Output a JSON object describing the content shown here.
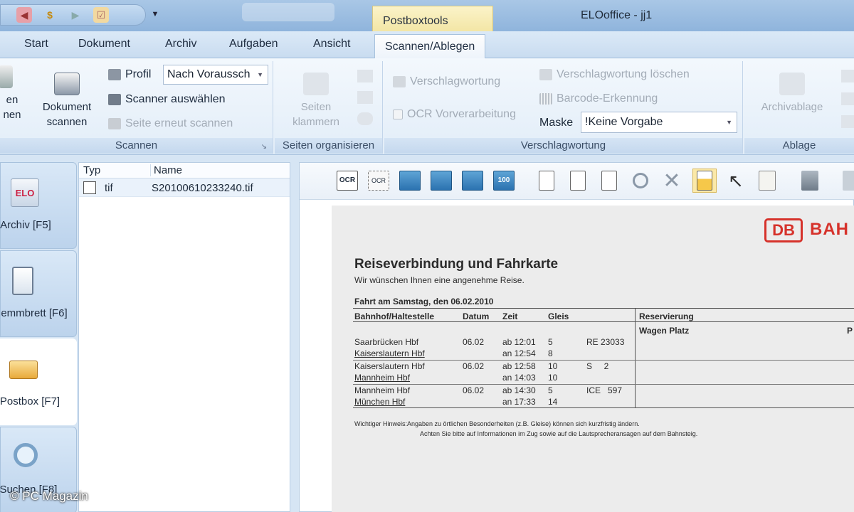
{
  "titlebar": {
    "context_tab": "Postboxtools",
    "app_title": "ELOoffice  -  jj1",
    "qat_icons": [
      "back-icon",
      "dollar-icon",
      "forward-icon",
      "checklist-icon"
    ]
  },
  "tabs": [
    {
      "label": "Start"
    },
    {
      "label": "Dokument"
    },
    {
      "label": "Archiv"
    },
    {
      "label": "Aufgaben"
    },
    {
      "label": "Ansicht"
    },
    {
      "label": "Scannen/Ablegen",
      "active": true
    }
  ],
  "ribbon": {
    "scannen": {
      "label": "Scannen",
      "partial_btn_line1": "en",
      "partial_btn_line2": "nen",
      "dokument_scannen_line1": "Dokument",
      "dokument_scannen_line2": "scannen",
      "profil_label": "Profil",
      "profil_value": "Nach Voraussch",
      "scanner_auswaehlen": "Scanner auswählen",
      "seite_erneut": "Seite erneut scannen"
    },
    "seiten": {
      "label": "Seiten organisieren",
      "klammern_line1": "Seiten",
      "klammern_line2": "klammern"
    },
    "verschlagwortung": {
      "label": "Verschlagwortung",
      "verschlagwortung": "Verschlagwortung",
      "ocr": "OCR Vorverarbeitung",
      "loeschen": "Verschlagwortung löschen",
      "barcode": "Barcode-Erkennung",
      "maske_label": "Maske",
      "maske_value": "!Keine Vorgabe"
    },
    "ablage": {
      "label": "Ablage",
      "archivablage": "Archivablage"
    }
  },
  "nav": [
    {
      "label": "Archiv [F5]",
      "icon": "elo-archive-icon"
    },
    {
      "label": "emmbrett [F6]",
      "icon": "clipboard-icon"
    },
    {
      "label": "Postbox [F7]",
      "icon": "inbox-tray-icon",
      "selected": true
    },
    {
      "label": "Suchen [F8]",
      "icon": "magnifier-icon"
    }
  ],
  "filelist": {
    "col_type": "Typ",
    "col_name": "Name",
    "rows": [
      {
        "type": "tif",
        "name": "S20100610233240.tif"
      }
    ]
  },
  "toolbar_icons": [
    "ocr-icon",
    "ocr-area-icon",
    "fit-width-icon",
    "fit-page-icon",
    "full-view-icon",
    "zoom-100-icon",
    "page-copy-icon",
    "page-rotate-icon",
    "page-move-icon",
    "magnify-icon",
    "delete-icon",
    "highlight-icon",
    "pointer-icon",
    "note-icon",
    "stamp-icon",
    "more-icon"
  ],
  "toolbar_labels": {
    "ocr": "OCR",
    "ocr2": "OCR",
    "zoom": "100"
  },
  "document": {
    "logo": "DB",
    "logo_text": "BAH",
    "title": "Reiseverbindung und Fahrkarte",
    "subtitle": "Wir wünschen Ihnen eine angenehme Reise.",
    "date_line": "Fahrt am Samstag, den 06.02.2010",
    "headers": {
      "station": "Bahnhof/Haltestelle",
      "datum": "Datum",
      "zeit": "Zeit",
      "gleis": "Gleis",
      "reservierung": "Reservierung",
      "wagen_platz": "Wagen   Platz",
      "p": "P"
    },
    "legs": [
      {
        "from": "Saarbrücken Hbf",
        "to": "Kaiserslautern Hbf",
        "datum": "06.02",
        "dep": "ab 12:01",
        "arr": "an 12:54",
        "g1": "5",
        "g2": "8",
        "train": "RE 23033"
      },
      {
        "from": "Kaiserslautern Hbf",
        "to": "Mannheim Hbf",
        "datum": "06.02",
        "dep": "ab 12:58",
        "arr": "an 14:03",
        "g1": "10",
        "g2": "10",
        "train": "S     2"
      },
      {
        "from": "Mannheim Hbf",
        "to": "München Hbf",
        "datum": "06.02",
        "dep": "ab 14:30",
        "arr": "an 17:33",
        "g1": "5",
        "g2": "14",
        "train": "ICE   597"
      }
    ],
    "note1": "Wichtiger Hinweis:Angaben zu örtlichen Besonderheiten (z.B. Gleise) können sich kurzfristig ändern.",
    "note2": "Achten Sie bitte auf Informationen im Zug sowie auf die Lautsprecheransagen auf dem Bahnsteig."
  },
  "watermark": "© PC Magazin",
  "colors": {
    "accent": "#d6322b",
    "ribbon": "#dbe9f7",
    "context": "#f3e6a6"
  }
}
